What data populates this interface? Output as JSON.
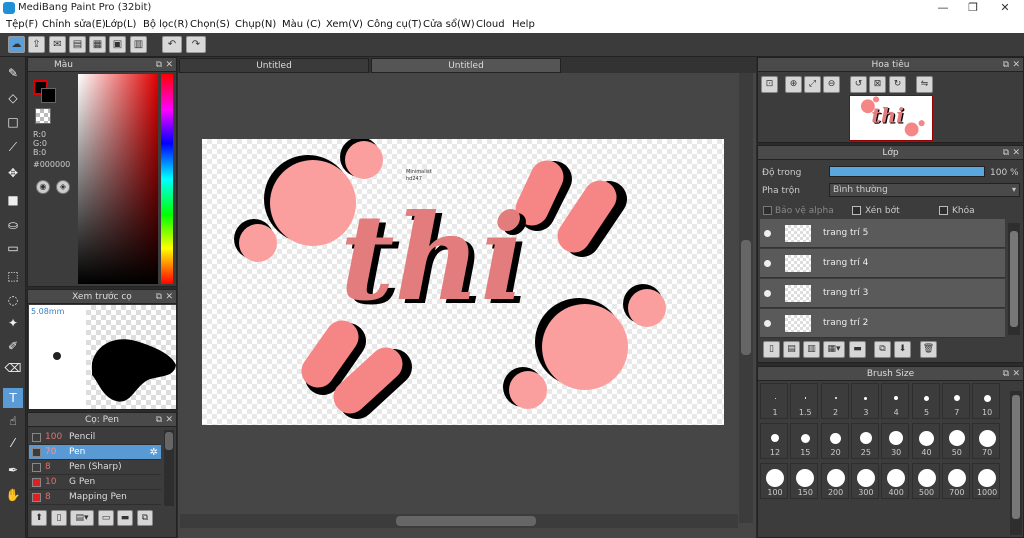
{
  "window": {
    "title": "MediBang Paint Pro (32bit)",
    "min": "—",
    "max": "❐",
    "close": "✕"
  },
  "menu": [
    "Tệp(F)",
    "Chỉnh sửa(E)",
    "Lớp(L)",
    "Bộ lọc(R)",
    "Chọn(S)",
    "Chụp(N)",
    "Màu (C)",
    "Xem(V)",
    "Công cụ(T)",
    "Cửa sổ(W)",
    "Cloud",
    "Help"
  ],
  "colorPanel": {
    "title": "Màu",
    "r": "R:0",
    "g": "G:0",
    "b": "B:0",
    "hex": "#000000",
    "fg": "#000000"
  },
  "brushPreview": {
    "title": "Xem trước cọ",
    "size": "5.08mm"
  },
  "brushList": {
    "title": "Cọ: Pen",
    "items": [
      {
        "size": "100",
        "name": "Pencil",
        "color": "#3c3c3c"
      },
      {
        "size": "70",
        "name": "Pen",
        "color": "#3c3c3c"
      },
      {
        "size": "8",
        "name": "Pen (Sharp)",
        "color": "#3c3c3c"
      },
      {
        "size": "10",
        "name": "G Pen",
        "color": "#e02020"
      },
      {
        "size": "8",
        "name": "Mapping Pen",
        "color": "#e02020"
      }
    ]
  },
  "tabs": [
    "Untitled",
    "Untitled"
  ],
  "canvasText": {
    "word": "thi",
    "note1": "Minimalist",
    "note2": "hd247"
  },
  "navigator": {
    "title": "Hoa tiêu"
  },
  "layers": {
    "title": "Lớp",
    "opacityLabel": "Độ trong",
    "opacityValue": "100 %",
    "opacity": 100,
    "blendLabel": "Pha trộn",
    "blendValue": "Bình thường",
    "protectAlpha": "Bảo vệ alpha",
    "clip": "Xén bớt",
    "lock": "Khóa",
    "items": [
      "trang trí 5",
      "trang trí 4",
      "trang trí 3",
      "trang trí 2"
    ]
  },
  "brushSize": {
    "title": "Brush Size",
    "values": [
      "1",
      "1.5",
      "2",
      "3",
      "4",
      "5",
      "7",
      "10",
      "12",
      "15",
      "20",
      "25",
      "30",
      "40",
      "50",
      "70",
      "100",
      "150",
      "200",
      "300",
      "400",
      "500",
      "700",
      "1000"
    ]
  },
  "colors": {
    "accent": "#5b9bd5",
    "salmon": "#f68686",
    "pink": "#fa9e9e"
  }
}
